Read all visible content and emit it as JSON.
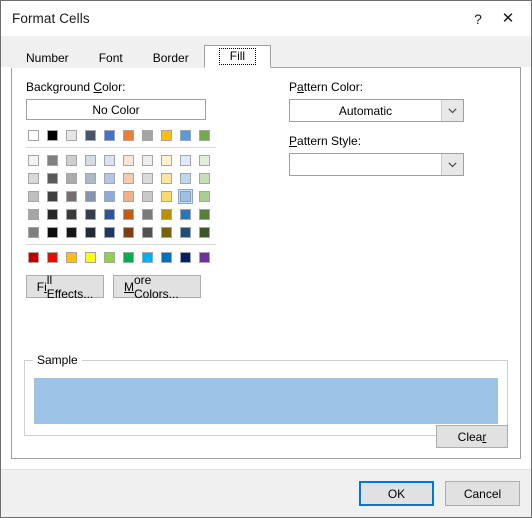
{
  "window": {
    "title": "Format Cells",
    "help_label": "?",
    "close_label": "✕"
  },
  "tabs": [
    {
      "label": "Number",
      "active": false
    },
    {
      "label": "Font",
      "active": false
    },
    {
      "label": "Border",
      "active": false
    },
    {
      "label": "Fill",
      "active": true
    }
  ],
  "background_color": {
    "label_pre": "Background ",
    "label_accel": "C",
    "label_post": "olor:",
    "no_color_label": "No Color",
    "theme_row": [
      "#ffffff",
      "#000000",
      "#e7e6e6",
      "#44546a",
      "#4472c4",
      "#ed7d31",
      "#a5a5a5",
      "#ffc000",
      "#5b9bd5",
      "#70ad47"
    ],
    "tint_rows": [
      [
        "#f2f2f2",
        "#808080",
        "#d0cece",
        "#d6dce4",
        "#d9e2f3",
        "#fbe5d5",
        "#ededed",
        "#fff2cc",
        "#deebf6",
        "#e2efd9"
      ],
      [
        "#d8d8d8",
        "#595959",
        "#aeabab",
        "#acb9ca",
        "#b4c6e7",
        "#f7cbac",
        "#dbdbdb",
        "#ffe598",
        "#bdd7ee",
        "#c5e0b3"
      ],
      [
        "#bfbfbf",
        "#404040",
        "#757070",
        "#8496b0",
        "#8eaadb",
        "#f4b083",
        "#c9c9c9",
        "#ffd965",
        "#9cc3e5",
        "#a8d08d"
      ],
      [
        "#a5a5a5",
        "#262626",
        "#3a3838",
        "#333f4f",
        "#2f5496",
        "#c55a11",
        "#7b7b7b",
        "#bf8f00",
        "#2e75b5",
        "#538135"
      ],
      [
        "#7f7f7f",
        "#0c0c0c",
        "#171616",
        "#222a35",
        "#1f3864",
        "#833c0b",
        "#525252",
        "#7f6000",
        "#1f4e79",
        "#375623"
      ]
    ],
    "standard_row": [
      "#c00000",
      "#ff0000",
      "#ffc000",
      "#ffff00",
      "#92d050",
      "#00b050",
      "#00b0f0",
      "#0070c0",
      "#002060",
      "#7030a0"
    ],
    "selected": {
      "row": 3,
      "col": 9,
      "color": "#9cc3e5"
    }
  },
  "fill_effects_button": {
    "label_pre": "F",
    "label_accel": "i",
    "label_post": "ll Effects..."
  },
  "more_colors_button": {
    "label_pre": "",
    "label_accel": "M",
    "label_post": "ore Colors..."
  },
  "pattern_color": {
    "label_pre": "P",
    "label_accel": "a",
    "label_post": "ttern Color:",
    "value": "Automatic"
  },
  "pattern_style": {
    "label_pre": "",
    "label_accel": "P",
    "label_post": "attern Style:",
    "value": ""
  },
  "sample": {
    "legend": "Sample",
    "fill_color": "#9dc3e6"
  },
  "clear_button": {
    "label_pre": "Clea",
    "label_accel": "r",
    "label_post": ""
  },
  "footer": {
    "ok_label": "OK",
    "cancel_label": "Cancel"
  },
  "colors": {
    "accent": "#0078d7",
    "dialog_bg": "#ffffff",
    "panel_bg": "#f0f0f0",
    "border": "#a0a0a0"
  }
}
